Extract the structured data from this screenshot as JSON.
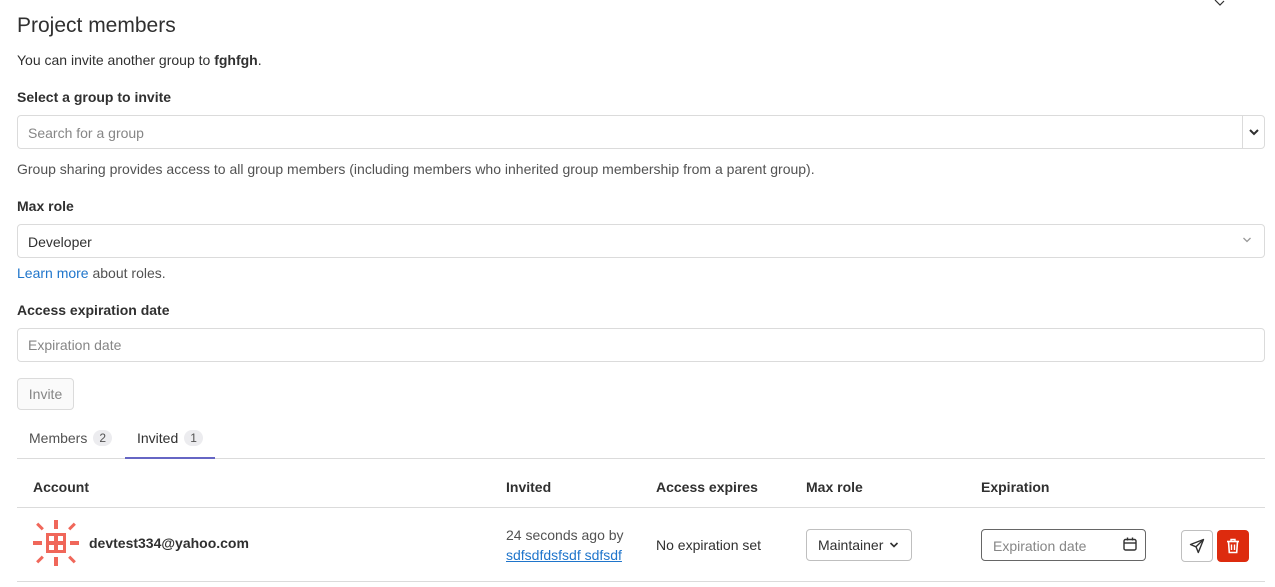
{
  "page": {
    "title": "Project members",
    "intro_prefix": "You can invite another group to ",
    "intro_project": "fghfgh",
    "intro_suffix": "."
  },
  "form": {
    "group_label": "Select a group to invite",
    "group_placeholder": "Search for a group",
    "group_help": "Group sharing provides access to all group members (including members who inherited group membership from a parent group).",
    "role_label": "Max role",
    "role_value": "Developer",
    "learn_link": "Learn more",
    "learn_suffix": " about roles.",
    "expiration_label": "Access expiration date",
    "expiration_placeholder": "Expiration date",
    "invite_button": "Invite"
  },
  "tabs": [
    {
      "label": "Members",
      "count": "2",
      "active": false
    },
    {
      "label": "Invited",
      "count": "1",
      "active": true
    }
  ],
  "table": {
    "columns": [
      "Account",
      "Invited",
      "Access expires",
      "Max role",
      "Expiration"
    ],
    "rows": [
      {
        "email": "devtest334@yahoo.com",
        "invited_time": "24 seconds ago by",
        "invited_by": "sdfsdfdsfsdf sdfsdf",
        "access_expires": "No expiration set",
        "max_role": "Maintainer",
        "expiration_placeholder": "Expiration date"
      }
    ]
  },
  "colors": {
    "link": "#1f75cb",
    "active_tab": "#6666c4",
    "danger": "#dd2b0e",
    "avatar": "#f0675a"
  },
  "icons": {
    "group_caret": "chevron-down-icon",
    "role_chevron": "chevron-down-icon",
    "calendar": "calendar-icon",
    "resend": "paper-airplane-icon",
    "remove": "trash-icon"
  }
}
